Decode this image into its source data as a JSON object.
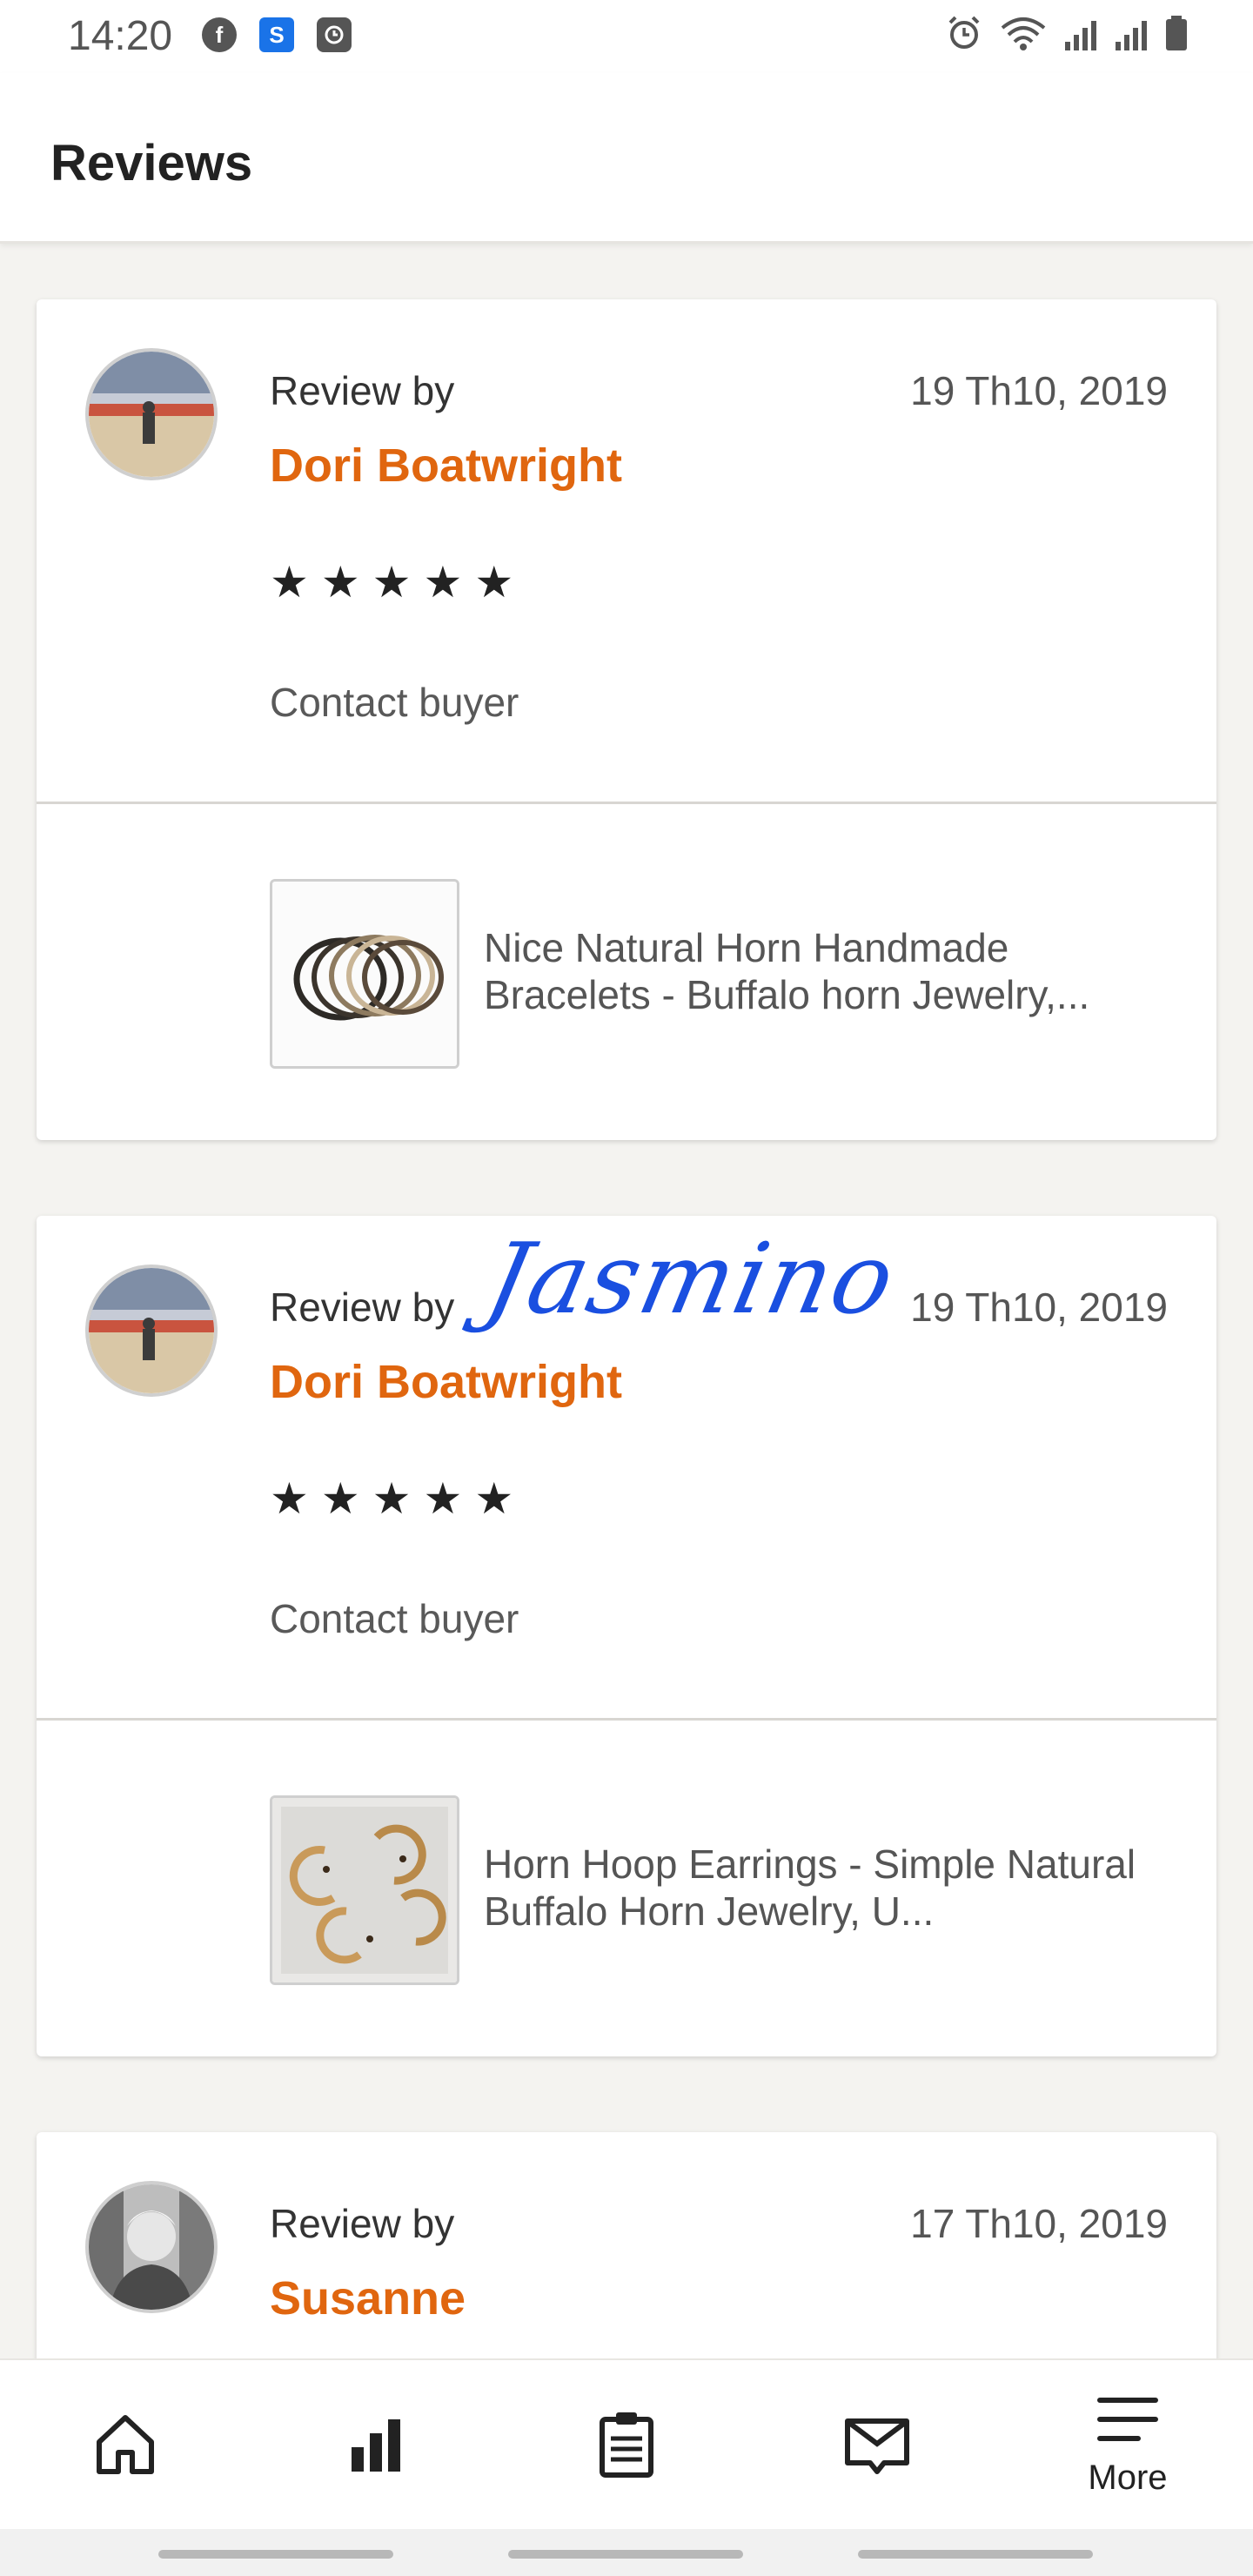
{
  "status_bar": {
    "time": "14:20",
    "left_icons": [
      "facebook-icon",
      "s-app-icon",
      "clock-app-icon"
    ],
    "right_icons": [
      "alarm-icon",
      "wifi-icon",
      "signal-icon",
      "signal-icon",
      "battery-icon"
    ]
  },
  "header": {
    "title": "Reviews"
  },
  "reviews": [
    {
      "review_by_label": "Review by",
      "reviewer": "Dori Boatwright",
      "date": "19 Th10, 2019",
      "rating": 5,
      "contact_label": "Contact buyer",
      "product_title": "Nice Natural Horn Handmade Bracelets - Buffalo horn Jewelry,..."
    },
    {
      "review_by_label": "Review by",
      "reviewer": "Dori Boatwright",
      "date": "19 Th10, 2019",
      "rating": 5,
      "contact_label": "Contact buyer",
      "product_title": "Horn Hoop Earrings - Simple Natural Buffalo Horn Jewelry, U..."
    },
    {
      "review_by_label": "Review by",
      "reviewer": "Susanne",
      "date": "17 Th10, 2019"
    }
  ],
  "overlay": {
    "signature_text": "Jasmino"
  },
  "bottom_nav": {
    "items": [
      {
        "icon": "home-icon"
      },
      {
        "icon": "stats-icon"
      },
      {
        "icon": "orders-clipboard-icon"
      },
      {
        "icon": "messages-icon"
      },
      {
        "icon": "menu-icon",
        "label": "More"
      }
    ]
  },
  "colors": {
    "accent": "#e0660f",
    "background": "#f4f3f0",
    "signature": "#1a4fe0"
  }
}
